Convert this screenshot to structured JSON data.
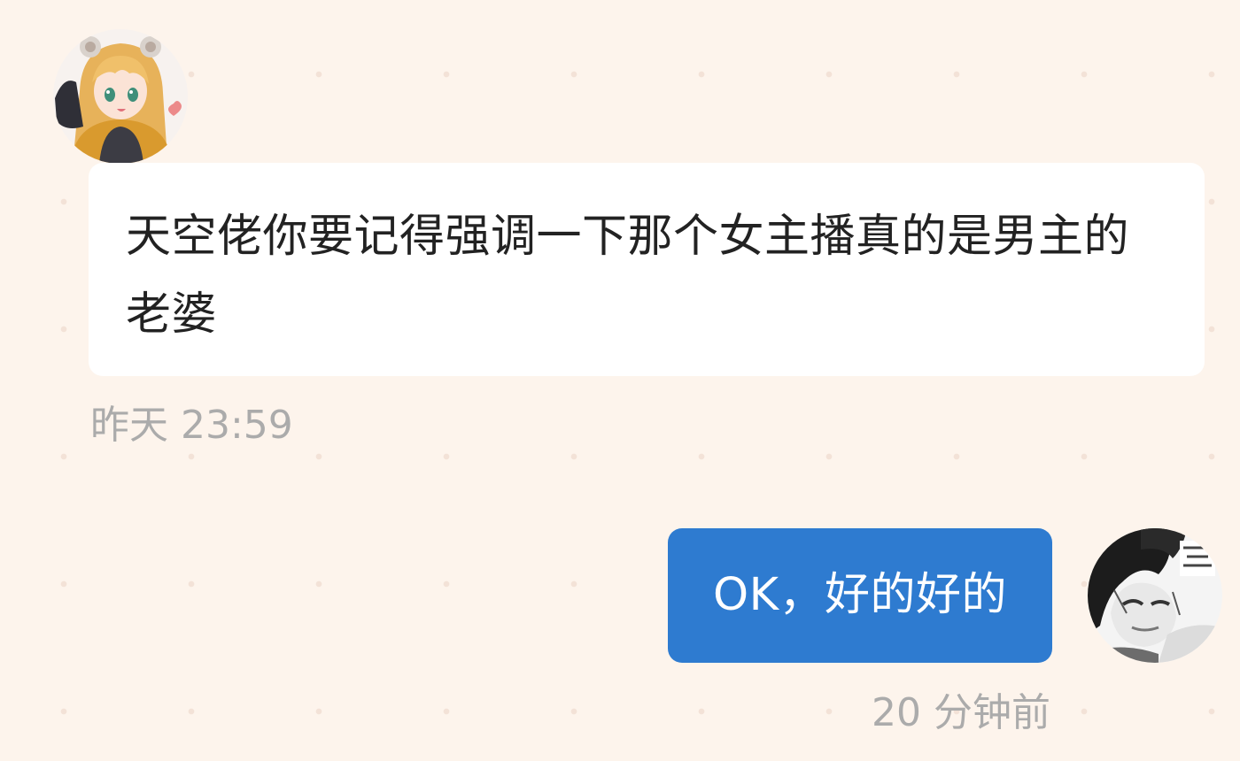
{
  "messages": [
    {
      "direction": "incoming",
      "avatar": "anime-girl-avatar",
      "text": "天空佬你要记得强调一下那个女主播真的是男主的老婆",
      "timestamp": "昨天 23:59"
    },
    {
      "direction": "outgoing",
      "avatar": "manga-character-avatar",
      "text": "OK，好的好的",
      "timestamp": "20 分钟前"
    }
  ],
  "colors": {
    "background": "#fdf4ec",
    "incoming_bubble": "#ffffff",
    "outgoing_bubble": "#2e7bd0",
    "timestamp_text": "#ababab"
  }
}
